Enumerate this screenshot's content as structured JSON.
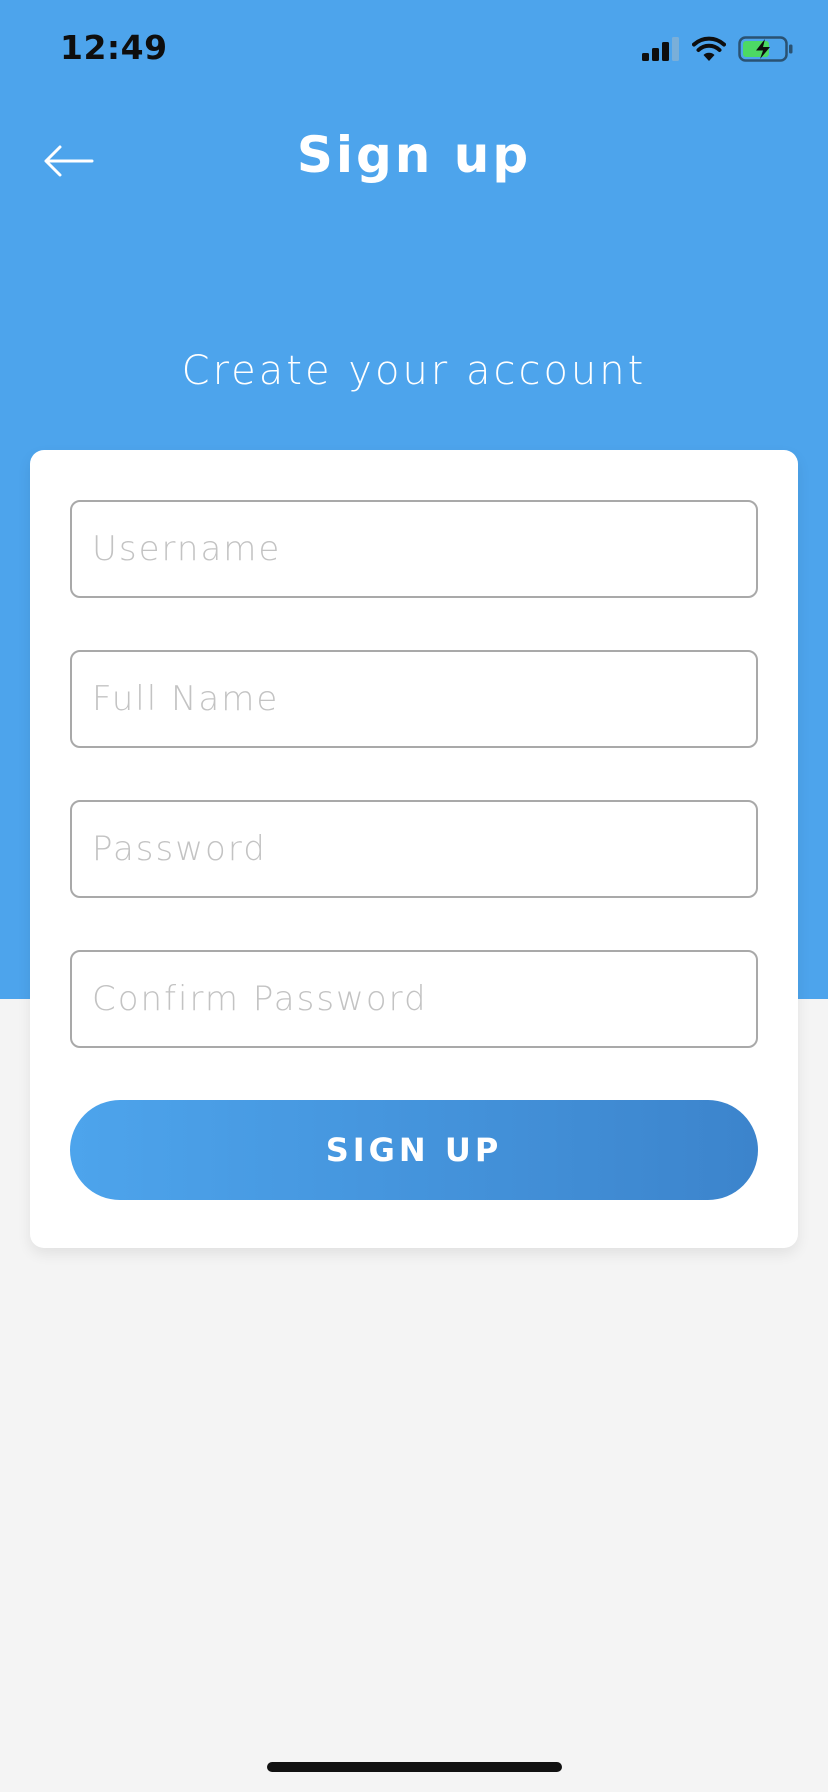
{
  "status_bar": {
    "time": "12:49",
    "icons": [
      "cellular-signal-icon",
      "wifi-icon",
      "battery-charging-icon"
    ]
  },
  "header": {
    "title": "Sign up",
    "back_icon": "arrow-left-icon"
  },
  "subtitle": "Create your account",
  "form": {
    "username": {
      "placeholder": "Username",
      "value": ""
    },
    "full_name": {
      "placeholder": "Full Name",
      "value": ""
    },
    "password": {
      "placeholder": "Password",
      "value": ""
    },
    "confirm_password": {
      "placeholder": "Confirm Password",
      "value": ""
    },
    "submit_label": "SIGN UP"
  },
  "colors": {
    "primary": "#4DA4EC",
    "primary_dark": "#3C84CC",
    "background": "#F4F4F4",
    "card": "#FFFFFF",
    "battery_fill": "#4CD964"
  }
}
